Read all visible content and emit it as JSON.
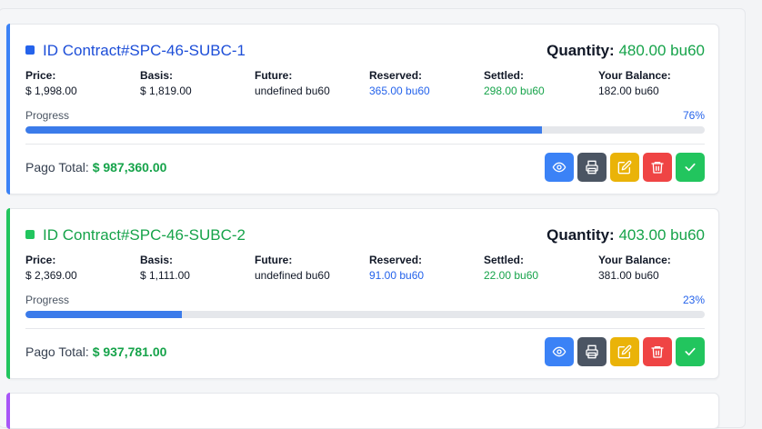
{
  "contracts": [
    {
      "title": "ID Contract#SPC-46-SUBC-1",
      "title_color": "#1d4ed8",
      "dot_color": "#2563eb",
      "accent": "#3b82f6",
      "quantity_label": "Quantity:",
      "quantity_value": "480.00 bu60",
      "stats": {
        "price": {
          "label": "Price:",
          "value": "$ 1,998.00"
        },
        "basis": {
          "label": "Basis:",
          "value": "$ 1,819.00"
        },
        "future": {
          "label": "Future:",
          "value": "undefined bu60"
        },
        "reserved": {
          "label": "Reserved:",
          "value": "365.00 bu60"
        },
        "settled": {
          "label": "Settled:",
          "value": "298.00 bu60"
        },
        "balance": {
          "label": "Your Balance:",
          "value": "182.00 bu60"
        }
      },
      "progress_label": "Progress",
      "progress_pct": "76%",
      "progress_value": 0.76,
      "pago_label": "Pago Total:",
      "pago_amount": "$ 987,360.00"
    },
    {
      "title": "ID Contract#SPC-46-SUBC-2",
      "title_color": "#16a34a",
      "dot_color": "#22c55e",
      "accent": "#22c55e",
      "quantity_label": "Quantity:",
      "quantity_value": "403.00 bu60",
      "stats": {
        "price": {
          "label": "Price:",
          "value": "$ 2,369.00"
        },
        "basis": {
          "label": "Basis:",
          "value": "$ 1,111.00"
        },
        "future": {
          "label": "Future:",
          "value": "undefined bu60"
        },
        "reserved": {
          "label": "Reserved:",
          "value": "91.00 bu60"
        },
        "settled": {
          "label": "Settled:",
          "value": "22.00 bu60"
        },
        "balance": {
          "label": "Your Balance:",
          "value": "381.00 bu60"
        }
      },
      "progress_label": "Progress",
      "progress_pct": "23%",
      "progress_value": 0.23,
      "pago_label": "Pago Total:",
      "pago_amount": "$ 937,781.00"
    }
  ],
  "actions": {
    "view_icon": "eye-icon",
    "print_icon": "printer-icon",
    "edit_icon": "edit-icon",
    "delete_icon": "trash-icon",
    "confirm_icon": "check-icon"
  },
  "colors": {
    "view": "#3b82f6",
    "print": "#4b5563",
    "edit": "#eab308",
    "delete": "#ef4444",
    "confirm": "#22c55e",
    "third_card_accent": "#a855f7"
  }
}
